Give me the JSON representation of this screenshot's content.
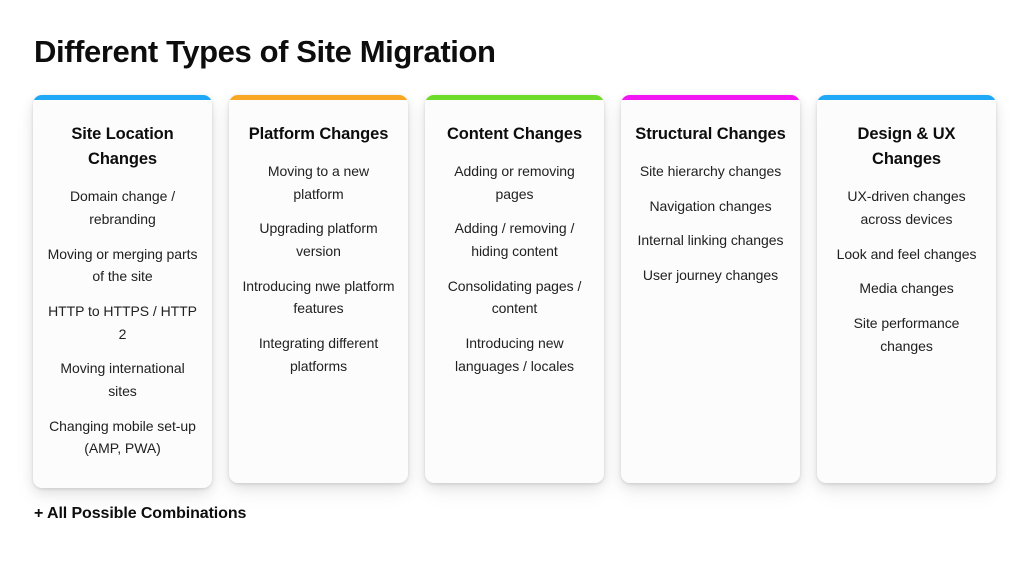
{
  "page": {
    "title": "Different Types of Site Migration",
    "footnote": "+ All Possible Combinations",
    "background_color": "#ffffff",
    "card_background_color": "#fcfcfc",
    "text_color": "#212121"
  },
  "cards": [
    {
      "accent_color": "#1fa8f5",
      "title": "Site Location Changes",
      "items": [
        "Domain change / rebranding",
        "Moving or merging parts of the site",
        "HTTP to HTTPS / HTTP 2",
        "Moving international sites",
        "Changing mobile set-up (AMP, PWA)"
      ]
    },
    {
      "accent_color": "#f9a825",
      "title": "Platform Changes",
      "items": [
        "Moving to a new platform",
        "Upgrading platform version",
        "Introducing nwe platform features",
        "Integrating different platforms"
      ]
    },
    {
      "accent_color": "#6ddb2a",
      "title": "Content Changes",
      "items": [
        "Adding or removing pages",
        "Adding / removing / hiding content",
        "Consolidating pages / content",
        "Introducing new languages / locales"
      ]
    },
    {
      "accent_color": "#f316f3",
      "title": "Structural Changes",
      "items": [
        "Site hierarchy changes",
        "Navigation changes",
        "Internal linking changes",
        "User journey changes"
      ]
    },
    {
      "accent_color": "#1fa8f5",
      "title": "Design & UX Changes",
      "items": [
        "UX-driven changes across devices",
        "Look and feel changes",
        "Media changes",
        "Site performance changes"
      ]
    }
  ]
}
